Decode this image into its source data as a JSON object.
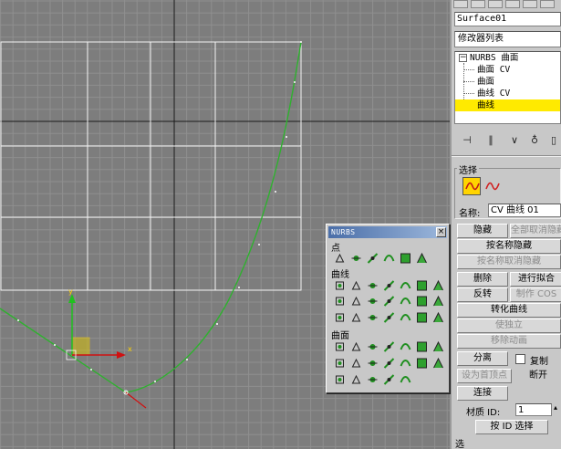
{
  "viewport": {
    "grid_color": "#8f8f8f",
    "axis_color": "#000000",
    "bg_color": "#7d7d7d",
    "curve_color": "#2fb12f",
    "gizmo_labels": {
      "x": "x",
      "y": "y"
    }
  },
  "panel": {
    "object_name": "Surface01",
    "modifier_list": "修改器列表",
    "stack": {
      "root": "NURBS 曲面",
      "items": [
        "曲面 CV",
        "曲面",
        "曲线 CV",
        "曲线"
      ],
      "selected": "曲线"
    },
    "selection_rollout": {
      "title": "选择",
      "name_label": "名称:",
      "name_value": "CV 曲线 01",
      "buttons": {
        "hide": "隐藏",
        "unhide_all": "全部取消隐藏",
        "hide_by_name": "按名称隐藏",
        "unhide_by_name": "按名称取消隐藏",
        "delete": "删除",
        "fit": "进行拟合",
        "reverse": "反转",
        "make_cos": "制作 COS",
        "convert_curve": "转化曲线",
        "make_independent": "使独立",
        "remove_anim": "移除动画",
        "detach": "分离",
        "copy_label": "复制",
        "make_first": "设为首顶点",
        "break": "断开",
        "connect": "连接",
        "mat_id_label": "材质 ID:",
        "mat_id_value": "1",
        "select_by_id": "按 ID 选择"
      },
      "bottom_label": "选"
    },
    "accent_color": "#ffea00"
  },
  "nurbs_toolbox": {
    "title": "NURBS",
    "sections": [
      "点",
      "曲线",
      "曲面"
    ]
  }
}
